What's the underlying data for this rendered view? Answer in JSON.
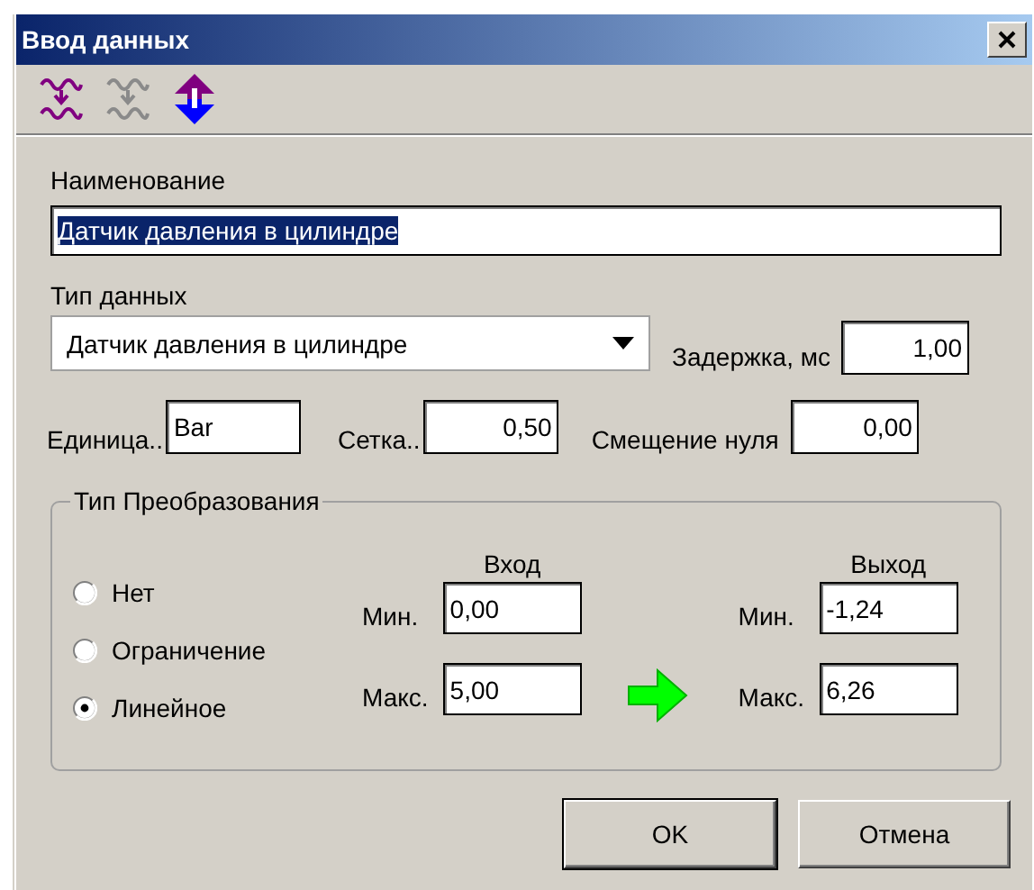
{
  "window": {
    "title": "Ввод данных"
  },
  "toolbar": [
    {
      "kind": "wave",
      "disabled": false
    },
    {
      "kind": "wave",
      "disabled": true
    },
    {
      "kind": "updown",
      "disabled": false
    }
  ],
  "name": {
    "label": "Наименование",
    "value": "Датчик давления в цилиндре",
    "highlighted": true
  },
  "data_type": {
    "label": "Тип данных",
    "value": "Датчик давления в цилиндре"
  },
  "delay": {
    "label": "Задержка, мс",
    "value": "1,00"
  },
  "unit": {
    "label": "Единица..",
    "value": "Bar"
  },
  "grid": {
    "label": "Сетка..",
    "value": "0,50"
  },
  "zero_offset": {
    "label": "Смещение нуля",
    "value": "0,00"
  },
  "conversion": {
    "title": "Тип Преобразования",
    "options": [
      {
        "label": "Нет",
        "selected": false
      },
      {
        "label": "Ограничение",
        "selected": false
      },
      {
        "label": "Линейное",
        "selected": true
      }
    ],
    "input": {
      "title": "Вход",
      "min_label": "Мин.",
      "min": "0,00",
      "max_label": "Макс.",
      "max": "5,00"
    },
    "output": {
      "title": "Выход",
      "min_label": "Мин.",
      "min": "-1,24",
      "max_label": "Макс.",
      "max": "6,26"
    }
  },
  "buttons": [
    {
      "label": "OK",
      "default": true
    },
    {
      "label": "Отмена",
      "default": false
    }
  ]
}
